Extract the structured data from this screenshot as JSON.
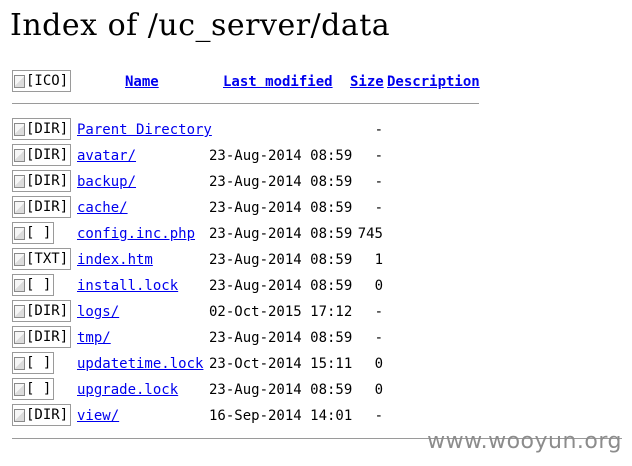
{
  "page": {
    "title": "Index of /uc_server/data"
  },
  "header": {
    "icon_alt": "[ICO]",
    "name": "Name",
    "last_modified": "Last modified",
    "size": "Size",
    "description": "Description"
  },
  "rows": [
    {
      "icon": "[DIR]",
      "name": "Parent Directory",
      "modified": "",
      "size": "-"
    },
    {
      "icon": "[DIR]",
      "name": "avatar/",
      "modified": "23-Aug-2014 08:59",
      "size": "-"
    },
    {
      "icon": "[DIR]",
      "name": "backup/",
      "modified": "23-Aug-2014 08:59",
      "size": "-"
    },
    {
      "icon": "[DIR]",
      "name": "cache/",
      "modified": "23-Aug-2014 08:59",
      "size": "-"
    },
    {
      "icon": "[ ]",
      "name": "config.inc.php",
      "modified": "23-Aug-2014 08:59",
      "size": "745"
    },
    {
      "icon": "[TXT]",
      "name": "index.htm",
      "modified": "23-Aug-2014 08:59",
      "size": "1"
    },
    {
      "icon": "[ ]",
      "name": "install.lock",
      "modified": "23-Aug-2014 08:59",
      "size": "0"
    },
    {
      "icon": "[DIR]",
      "name": "logs/",
      "modified": "02-Oct-2015 17:12",
      "size": "-"
    },
    {
      "icon": "[DIR]",
      "name": "tmp/",
      "modified": "23-Aug-2014 08:59",
      "size": "-"
    },
    {
      "icon": "[ ]",
      "name": "updatetime.lock",
      "modified": "23-Oct-2014 15:11",
      "size": "0"
    },
    {
      "icon": "[ ]",
      "name": "upgrade.lock",
      "modified": "23-Aug-2014 08:59",
      "size": "0"
    },
    {
      "icon": "[DIR]",
      "name": "view/",
      "modified": "16-Sep-2014 14:01",
      "size": "-"
    }
  ],
  "watermark": "www.wooyun.org"
}
